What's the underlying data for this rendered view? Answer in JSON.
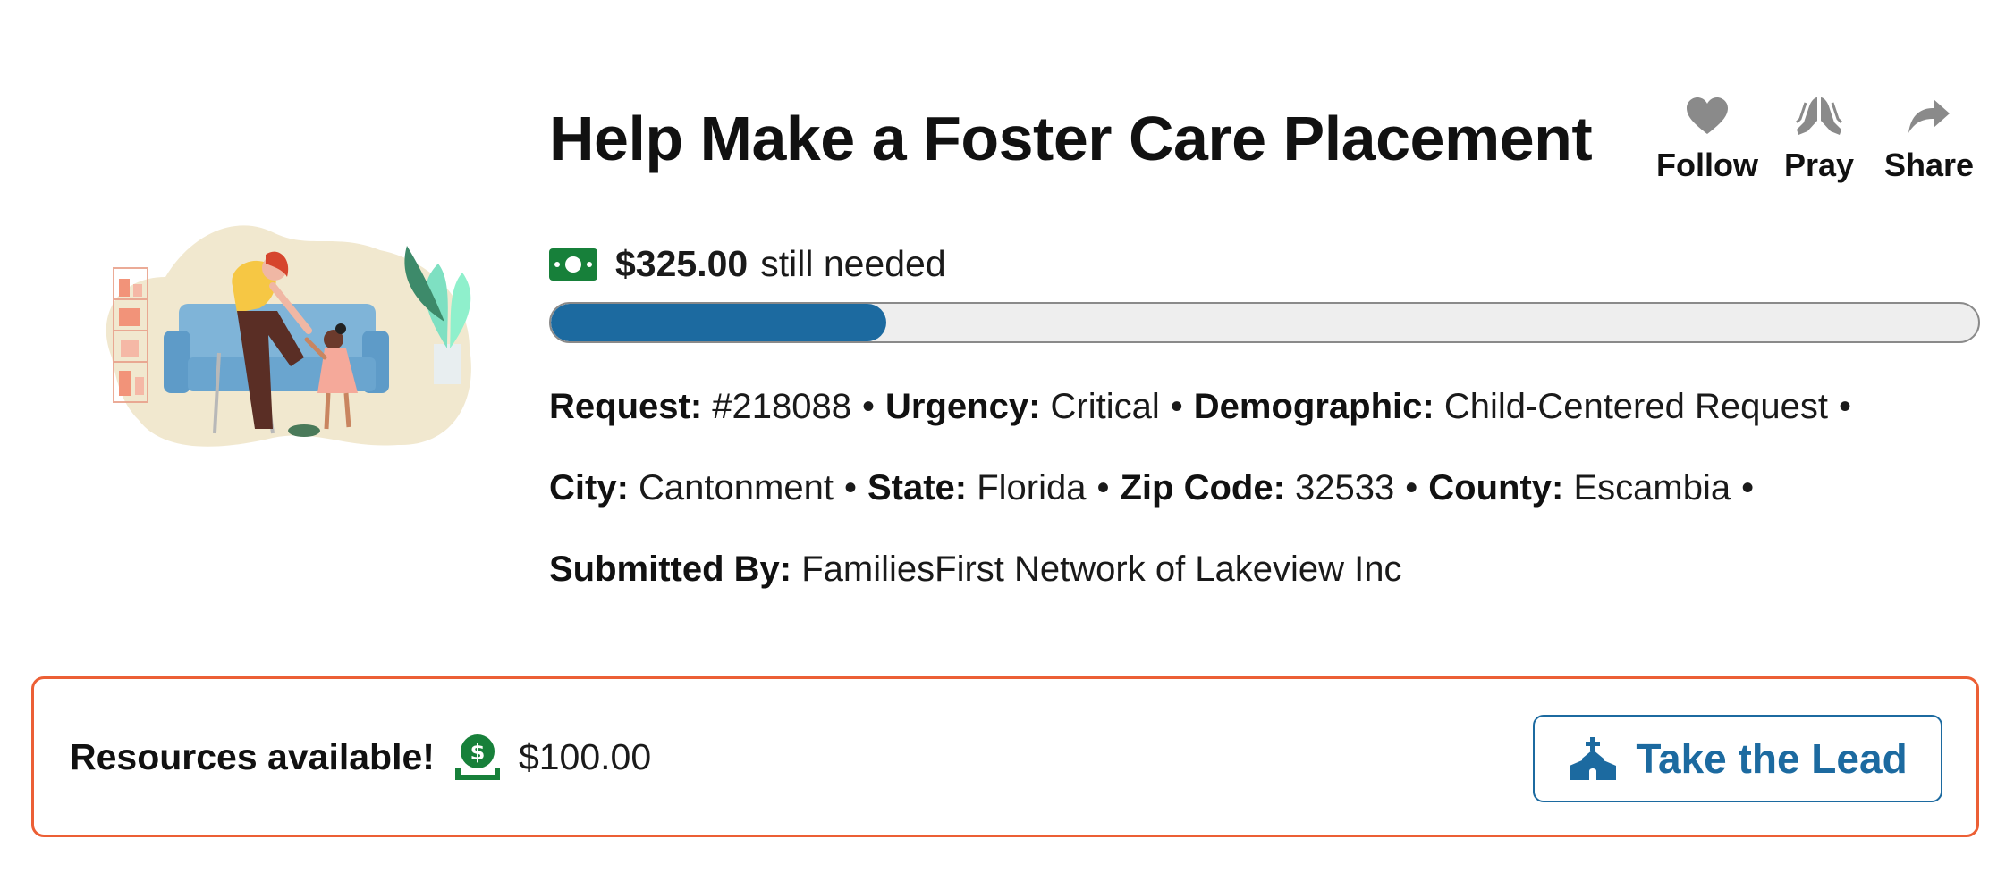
{
  "request": {
    "title": "Help Make a Foster Care Placement",
    "amount_needed": "$325.00",
    "needed_suffix": "still needed",
    "progress_fraction": 0.235,
    "separator": "•",
    "meta": {
      "request_label": "Request:",
      "request_value": "#218088",
      "urgency_label": "Urgency:",
      "urgency_value": "Critical",
      "demographic_label": "Demographic:",
      "demographic_value": "Child-Centered Request",
      "city_label": "City:",
      "city_value": "Cantonment",
      "state_label": "State:",
      "state_value": "Florida",
      "zip_label": "Zip Code:",
      "zip_value": "32533",
      "county_label": "County:",
      "county_value": "Escambia",
      "submitted_label": "Submitted By:",
      "submitted_value": "FamiliesFirst Network of Lakeview Inc"
    }
  },
  "actions": {
    "follow": {
      "label": "Follow",
      "icon": "heart-icon"
    },
    "pray": {
      "label": "Pray",
      "icon": "praying-hands-icon"
    },
    "share": {
      "label": "Share",
      "icon": "share-arrow-icon"
    }
  },
  "resources": {
    "label": "Resources available!",
    "amount": "$100.00",
    "icon": "money-hand-icon",
    "button_label": "Take the Lead",
    "button_icon": "church-icon"
  },
  "colors": {
    "accent_blue": "#1c6aa0",
    "money_green": "#17803a",
    "alert_orange": "#ec5f35",
    "icon_gray": "#8a8a8a"
  }
}
